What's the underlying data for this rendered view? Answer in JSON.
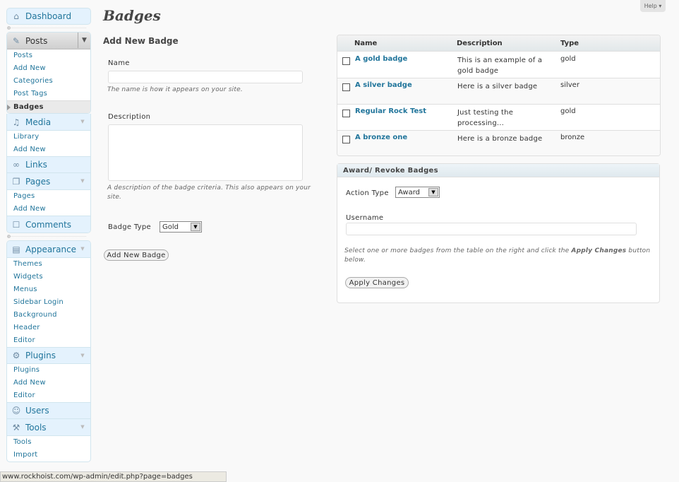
{
  "page": {
    "title": "Badges",
    "help_label": "Help ▾"
  },
  "sidebar": {
    "dashboard": "Dashboard",
    "posts": {
      "label": "Posts",
      "items": [
        "Posts",
        "Add New",
        "Categories",
        "Post Tags",
        "Badges"
      ]
    },
    "media": {
      "label": "Media",
      "items": [
        "Library",
        "Add New"
      ]
    },
    "links": {
      "label": "Links"
    },
    "pages": {
      "label": "Pages",
      "items": [
        "Pages",
        "Add New"
      ]
    },
    "comments": {
      "label": "Comments"
    },
    "appearance": {
      "label": "Appearance",
      "items": [
        "Themes",
        "Widgets",
        "Menus",
        "Sidebar Login",
        "Background",
        "Header",
        "Editor"
      ]
    },
    "plugins": {
      "label": "Plugins",
      "items": [
        "Plugins",
        "Add New",
        "Editor"
      ]
    },
    "users": {
      "label": "Users"
    },
    "tools": {
      "label": "Tools",
      "items": [
        "Tools",
        "Import"
      ]
    }
  },
  "add_form": {
    "title": "Add New Badge",
    "name_label": "Name",
    "name_value": "",
    "name_hint": "The name is how it appears on your site.",
    "description_label": "Description",
    "description_value": "",
    "description_hint": "A description of the badge criteria. This also appears on your site.",
    "type_label": "Badge Type",
    "type_value": "Gold",
    "submit_label": "Add New Badge"
  },
  "table": {
    "columns": [
      "Name",
      "Description",
      "Type"
    ],
    "rows": [
      {
        "name": "A gold badge",
        "description": "This is an example of a gold badge",
        "type": "gold"
      },
      {
        "name": "A silver badge",
        "description": "Here is a silver badge",
        "type": "silver"
      },
      {
        "name": "Regular Rock Test",
        "description": "Just testing the processing...",
        "type": "gold"
      },
      {
        "name": "A bronze one",
        "description": "Here is a bronze badge",
        "type": "bronze"
      }
    ]
  },
  "award": {
    "title": "Award/ Revoke Badges",
    "action_label": "Action Type",
    "action_value": "Award",
    "username_label": "Username",
    "username_value": "",
    "help_pre": "Select one or more badges from the table on the right and click the ",
    "help_em": "Apply Changes",
    "help_post": " button below.",
    "apply_label": "Apply Changes"
  },
  "statusbar": {
    "url": "www.rockhoist.com/wp-admin/edit.php?page=badges"
  },
  "colors": {
    "link": "#21759b",
    "menu_bg": "#e4f2fd"
  }
}
